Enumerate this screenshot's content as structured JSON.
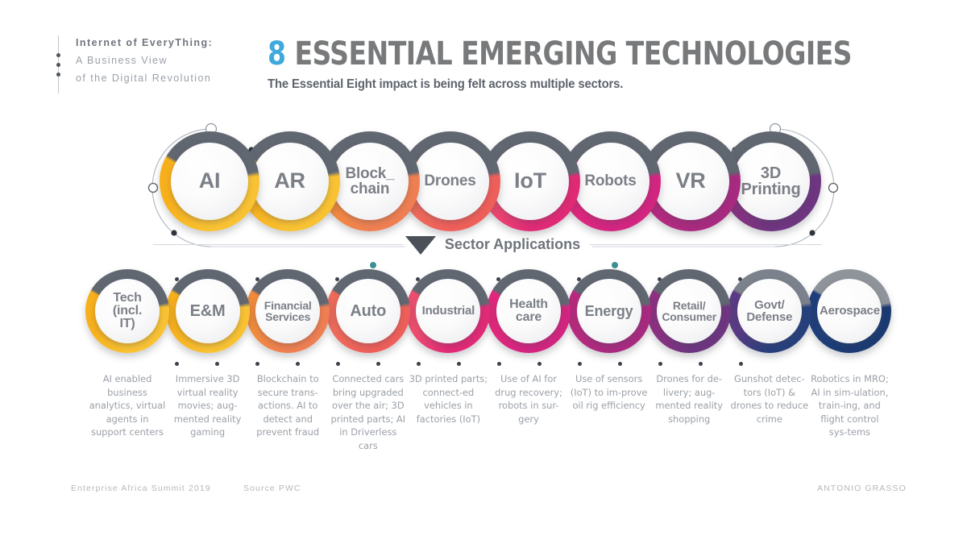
{
  "header": {
    "brand_line_1": "Internet of EveryThing:",
    "brand_line_2": "A Business View",
    "brand_line_3": "of the Digital Revolution",
    "title_number": "8",
    "title_rest": "ESSENTIAL EMERGING TECHNOLOGIES",
    "subtitle": "The Essential Eight impact is being felt across multiple sectors.",
    "accent_color": "#3fa9dd",
    "title_color": "#78797b"
  },
  "divider": {
    "label": "Sector Applications"
  },
  "technologies": [
    {
      "label": "AI",
      "color_a": "#f7b01c",
      "color_b": "#f9c233",
      "gray": "#616771",
      "font_size": "27px"
    },
    {
      "label": "AR",
      "color_a": "#f7b01c",
      "color_b": "#f9c233",
      "gray": "#616771",
      "font_size": "27px"
    },
    {
      "label": "Block_\nchain",
      "color_a": "#f28b3c",
      "color_b": "#ef7f52",
      "gray": "#616771",
      "font_size": "19px"
    },
    {
      "label": "Drones",
      "color_a": "#ef6b5a",
      "color_b": "#ee5f5a",
      "gray": "#616771",
      "font_size": "19px"
    },
    {
      "label": "IoT",
      "color_a": "#ef4e6e",
      "color_b": "#e02a76",
      "gray": "#616771",
      "font_size": "27px"
    },
    {
      "label": "Robots",
      "color_a": "#e3277c",
      "color_b": "#d22580",
      "gray": "#616771",
      "font_size": "19px"
    },
    {
      "label": "VR",
      "color_a": "#b92a7f",
      "color_b": "#a82a80",
      "gray": "#616771",
      "font_size": "27px"
    },
    {
      "label": "3D\nPrinting",
      "color_a": "#8e3182",
      "color_b": "#6e3580",
      "gray": "#616771",
      "font_size": "20px"
    }
  ],
  "sectors": [
    {
      "label": "Tech\n(incl.\nIT)",
      "color_a": "#f7b01c",
      "color_b": "#f9c233",
      "gray": "#616771",
      "font_size": "16px",
      "caption": "AI enabled business analytics, virtual agents in support centers"
    },
    {
      "label": "E&M",
      "color_a": "#f7b01c",
      "color_b": "#f9c233",
      "gray": "#616771",
      "font_size": "20px",
      "caption": "Immersive 3D virtual reality movies; aug-mented reality gaming"
    },
    {
      "label": "Financial\nServices",
      "color_a": "#f28b3c",
      "color_b": "#ef7f52",
      "gray": "#616771",
      "font_size": "14px",
      "caption": "Blockchain to secure trans-actions. AI to detect and prevent fraud"
    },
    {
      "label": "Auto",
      "color_a": "#ef6b5a",
      "color_b": "#ee5f5a",
      "gray": "#616771",
      "font_size": "20px",
      "caption": "Connected cars bring upgraded over the air; 3D printed parts; AI in Driverless cars"
    },
    {
      "label": "Industrial",
      "color_a": "#ef4e6e",
      "color_b": "#e02a76",
      "gray": "#616771",
      "font_size": "15px",
      "caption": "3D printed parts; connect-ed vehicles in factories (IoT)"
    },
    {
      "label": "Health\ncare",
      "color_a": "#e3277c",
      "color_b": "#d22580",
      "gray": "#616771",
      "font_size": "16px",
      "caption": "Use of AI for drug recovery; robots in sur-gery"
    },
    {
      "label": "Energy",
      "color_a": "#b92a7f",
      "color_b": "#a82a80",
      "gray": "#616771",
      "font_size": "18px",
      "caption": "Use of sensors (IoT) to im-prove oil rig efficiency"
    },
    {
      "label": "Retail/\nConsumer",
      "color_a": "#8e3182",
      "color_b": "#6e3580",
      "gray": "#616771",
      "font_size": "14px",
      "caption": "Drones for de-livery; aug-mented reality shopping"
    },
    {
      "label": "Govt/\nDefense",
      "color_a": "#5b3b86",
      "color_b": "#26407c",
      "gray": "#7c828b",
      "font_size": "15px",
      "caption": "Gunshot detec-tors (IoT) & drones to reduce crime"
    },
    {
      "label": "Aerospace",
      "color_a": "#1f3f7c",
      "color_b": "#1b3a72",
      "gray": "#8f949b",
      "font_size": "15px",
      "caption": "Robotics in MRO; AI in sim-ulation, train-ing, and flight control sys-tems"
    }
  ],
  "footer": {
    "event": "Enterprise Africa Summit 2019",
    "source": "Source PWC",
    "author": "ANTONIO GRASSO"
  }
}
